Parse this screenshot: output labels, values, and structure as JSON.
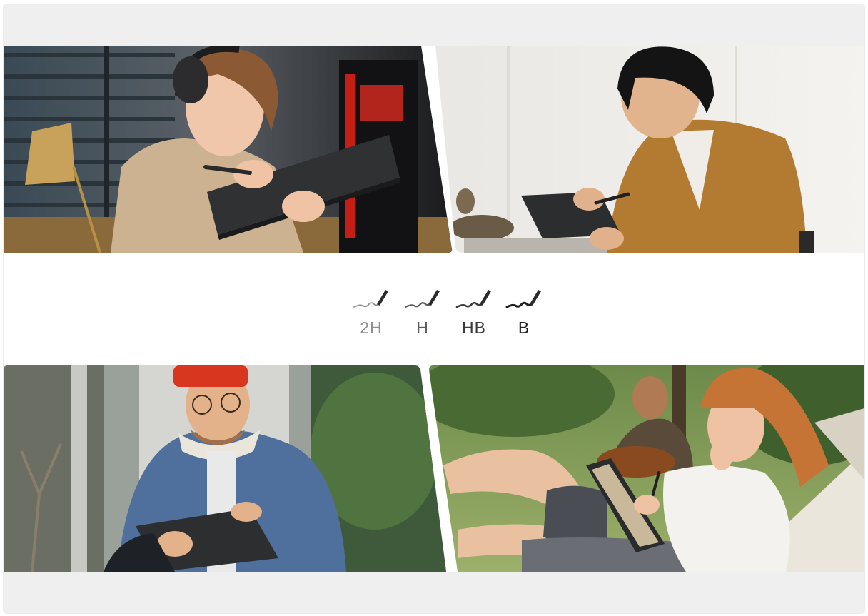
{
  "pencil_grades": [
    {
      "label": "2H",
      "color": "#8f8f8f"
    },
    {
      "label": "H",
      "color": "#5c5c5c"
    },
    {
      "label": "HB",
      "color": "#3a3a3a"
    },
    {
      "label": "B",
      "color": "#1e1e1e"
    }
  ],
  "colors": {
    "band": "#efefef",
    "background": "#ffffff"
  }
}
